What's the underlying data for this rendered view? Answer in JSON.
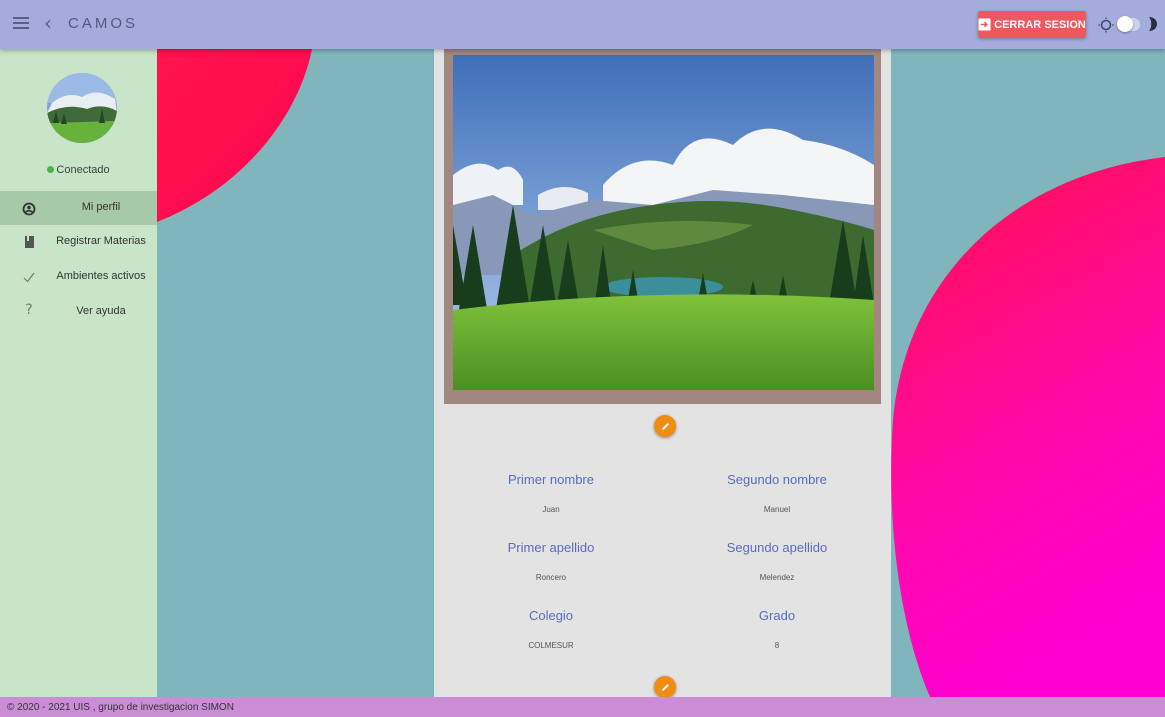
{
  "header": {
    "title": "CAMOS",
    "logout_label": "CERRAR SESION",
    "menu_icon": "hamburger-menu-icon",
    "back_icon": "chevron-left-icon",
    "theme_toggle": "off"
  },
  "sidebar": {
    "status": "Conectado",
    "items": [
      {
        "label": "Mi perfil",
        "icon": "account-circle-icon",
        "active": true
      },
      {
        "label": "Registrar Materias",
        "icon": "notebook-icon",
        "active": false
      },
      {
        "label": "Ambientes activos",
        "icon": "check-icon",
        "active": false
      },
      {
        "label": "Ver ayuda",
        "icon": "question-mark-icon",
        "active": false
      }
    ]
  },
  "profile": {
    "fields": [
      {
        "label": "Primer nombre",
        "value": "Juan"
      },
      {
        "label": "Segundo nombre",
        "value": "Manuel"
      },
      {
        "label": "Primer apellido",
        "value": "Roncero"
      },
      {
        "label": "Segundo apellido",
        "value": "Melendez"
      },
      {
        "label": "Colegio",
        "value": "COLMESUR"
      },
      {
        "label": "Grado",
        "value": "8"
      }
    ]
  },
  "footer": {
    "text": "© 2020 - 2021 UIS , grupo de investigacion SIMON"
  },
  "colors": {
    "topbar": "#a4acdc",
    "sidebar": "#c8e4c9",
    "background": "#80b6bb",
    "logout": "#f2575f",
    "accent_orange": "#f08c0f",
    "field_label": "#5a6bc0",
    "footer": "#cb8ed6"
  }
}
